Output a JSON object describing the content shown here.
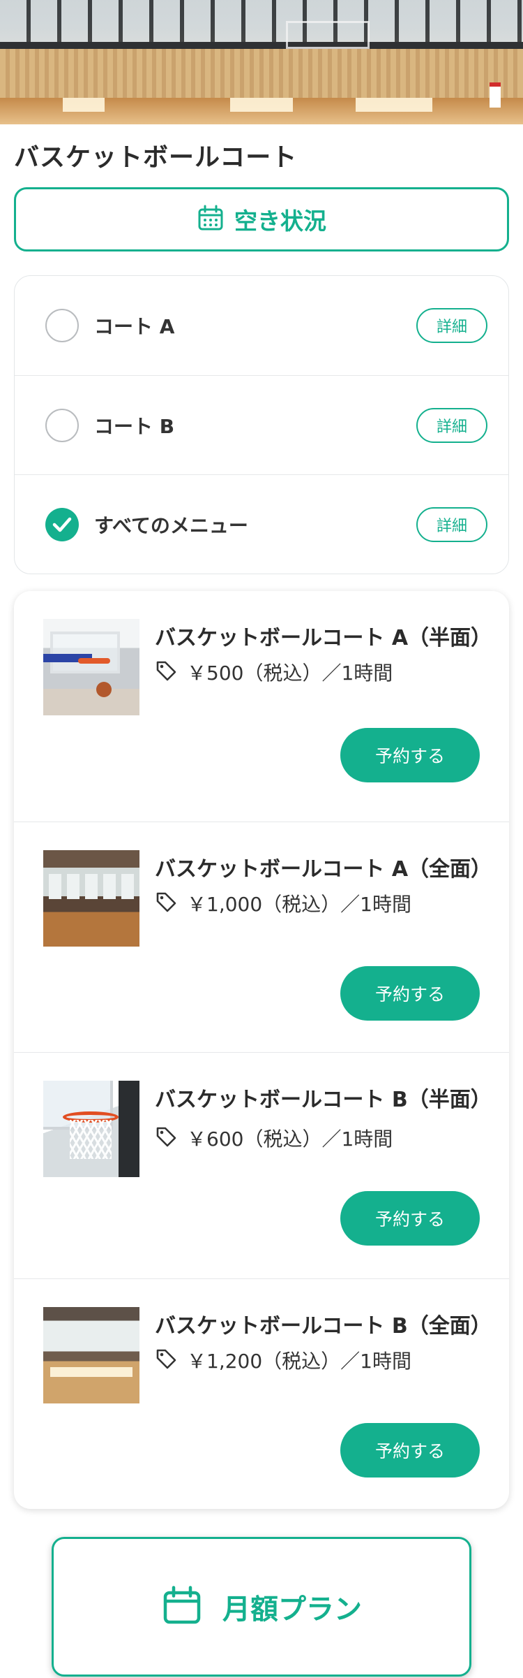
{
  "page": {
    "title": "バスケットボールコート"
  },
  "availability": {
    "label": "空き状況",
    "icon": "calendar-icon"
  },
  "filters": [
    {
      "label": "コート A",
      "selected": false,
      "detail_label": "詳細"
    },
    {
      "label": "コート B",
      "selected": false,
      "detail_label": "詳細"
    },
    {
      "label": "すべてのメニュー",
      "selected": true,
      "detail_label": "詳細"
    }
  ],
  "menus": [
    {
      "title": "バスケットボールコート A（半面）",
      "price": "￥500（税込）／1時間",
      "reserve_label": "予約する"
    },
    {
      "title": "バスケットボールコート A（全面）",
      "price": "￥1,000（税込）／1時間",
      "reserve_label": "予約する"
    },
    {
      "title": "バスケットボールコート B（半面）",
      "price": "￥600（税込）／1時間",
      "reserve_label": "予約する"
    },
    {
      "title": "バスケットボールコート B（全面）",
      "price": "￥1,200（税込）／1時間",
      "reserve_label": "予約する"
    }
  ],
  "monthly_plan": {
    "label": "月額プラン",
    "icon": "calendar-icon"
  },
  "colors": {
    "accent": "#14b08e",
    "text": "#2b2b2b",
    "border": "#e3e6e8"
  }
}
